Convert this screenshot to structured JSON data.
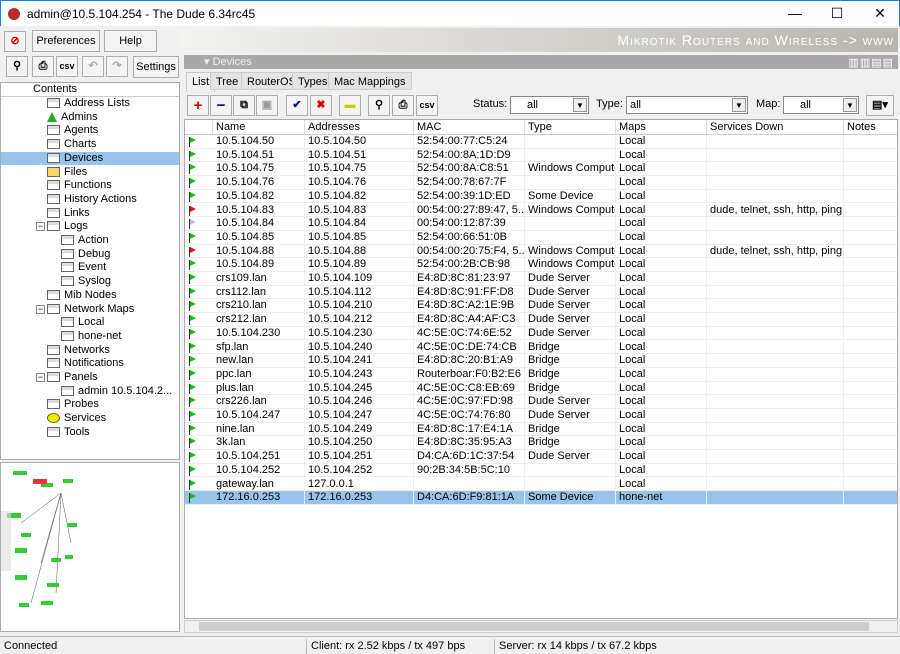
{
  "window": {
    "title": "admin@10.5.104.254 - The Dude 6.34rc45",
    "minimize": "—",
    "maximize": "☐",
    "close": "✕"
  },
  "menu": {
    "preferences": "Preferences",
    "help": "Help"
  },
  "banner": "Mikrotik Routers and Wireless -> www",
  "left_toolbar": {
    "csv": "csv",
    "settings": "Settings"
  },
  "tree": {
    "header": "Contents",
    "items": [
      {
        "label": "Address Lists",
        "level": 1,
        "icon": "table-icon"
      },
      {
        "label": "Admins",
        "level": 1,
        "icon": "admin-icon"
      },
      {
        "label": "Agents",
        "level": 1,
        "icon": "table-icon"
      },
      {
        "label": "Charts",
        "level": 1,
        "icon": "table-icon"
      },
      {
        "label": "Devices",
        "level": 1,
        "icon": "table-icon",
        "selected": true
      },
      {
        "label": "Files",
        "level": 1,
        "icon": "files-icon"
      },
      {
        "label": "Functions",
        "level": 1,
        "icon": "table-icon"
      },
      {
        "label": "History Actions",
        "level": 1,
        "icon": "table-icon"
      },
      {
        "label": "Links",
        "level": 1,
        "icon": "table-icon"
      },
      {
        "label": "Logs",
        "level": 1,
        "icon": "table-icon",
        "expanded": true
      },
      {
        "label": "Action",
        "level": 2,
        "icon": "log-icon"
      },
      {
        "label": "Debug",
        "level": 2,
        "icon": "log-icon"
      },
      {
        "label": "Event",
        "level": 2,
        "icon": "log-icon"
      },
      {
        "label": "Syslog",
        "level": 2,
        "icon": "log-icon"
      },
      {
        "label": "Mib Nodes",
        "level": 1,
        "icon": "table-icon"
      },
      {
        "label": "Network Maps",
        "level": 1,
        "icon": "table-icon",
        "expanded": true
      },
      {
        "label": "Local",
        "level": 2,
        "icon": "table-icon"
      },
      {
        "label": "hone-net",
        "level": 2,
        "icon": "table-icon"
      },
      {
        "label": "Networks",
        "level": 1,
        "icon": "table-icon"
      },
      {
        "label": "Notifications",
        "level": 1,
        "icon": "table-icon"
      },
      {
        "label": "Panels",
        "level": 1,
        "icon": "table-icon",
        "expanded": true
      },
      {
        "label": "admin 10.5.104.2...",
        "level": 2,
        "icon": "table-icon"
      },
      {
        "label": "Probes",
        "level": 1,
        "icon": "table-icon"
      },
      {
        "label": "Services",
        "level": 1,
        "icon": "services-icon"
      },
      {
        "label": "Tools",
        "level": 1,
        "icon": "table-icon"
      }
    ]
  },
  "devices": {
    "title": "Devices",
    "tabs": [
      "List",
      "Tree",
      "RouterOS",
      "Types",
      "Mac Mappings"
    ],
    "active_tab": "List",
    "toolbar": {
      "csv": "csv"
    },
    "filters": {
      "status_label": "Status:",
      "status_value": "all",
      "type_label": "Type:",
      "type_value": "all",
      "map_label": "Map:",
      "map_value": "all"
    },
    "columns": [
      "Name",
      "Addresses",
      "MAC",
      "Type",
      "Maps",
      "Services Down",
      "Notes"
    ],
    "status_colors": {
      "up": "#10c010",
      "down": "#e01010",
      "unknown": "#c0c0c0"
    },
    "rows": [
      {
        "status": "up",
        "name": "10.5.104.50",
        "addresses": "10.5.104.50",
        "mac": "52:54:00:77:C5:24",
        "type": "",
        "maps": "Local",
        "services_down": "",
        "notes": ""
      },
      {
        "status": "up",
        "name": "10.5.104.51",
        "addresses": "10.5.104.51",
        "mac": "52:54:00:8A:1D:D9",
        "type": "",
        "maps": "Local",
        "services_down": "",
        "notes": ""
      },
      {
        "status": "up",
        "name": "10.5.104.75",
        "addresses": "10.5.104.75",
        "mac": "52:54:00:8A:C8:51",
        "type": "Windows Computer",
        "maps": "Local",
        "services_down": "",
        "notes": ""
      },
      {
        "status": "up",
        "name": "10.5.104.76",
        "addresses": "10.5.104.76",
        "mac": "52:54:00:78:67:7F",
        "type": "",
        "maps": "Local",
        "services_down": "",
        "notes": ""
      },
      {
        "status": "up",
        "name": "10.5.104.82",
        "addresses": "10.5.104.82",
        "mac": "52:54:00:39:1D:ED",
        "type": "Some Device",
        "maps": "Local",
        "services_down": "",
        "notes": ""
      },
      {
        "status": "down",
        "name": "10.5.104.83",
        "addresses": "10.5.104.83",
        "mac": "00:54:00:27:89:47, 5...",
        "type": "Windows Computer",
        "maps": "Local",
        "services_down": "dude, telnet, ssh, http, ping,...",
        "notes": ""
      },
      {
        "status": "unknown",
        "name": "10.5.104.84",
        "addresses": "10.5.104.84",
        "mac": "00:54:00:12:87:39",
        "type": "",
        "maps": "Local",
        "services_down": "",
        "notes": ""
      },
      {
        "status": "up",
        "name": "10.5.104.85",
        "addresses": "10.5.104.85",
        "mac": "52:54:00:66:51:0B",
        "type": "",
        "maps": "Local",
        "services_down": "",
        "notes": ""
      },
      {
        "status": "down",
        "name": "10.5.104.88",
        "addresses": "10.5.104.88",
        "mac": "00:54:00:20:75:F4, 5...",
        "type": "Windows Computer",
        "maps": "Local",
        "services_down": "dude, telnet, ssh, http, ping,...",
        "notes": ""
      },
      {
        "status": "up",
        "name": "10.5.104.89",
        "addresses": "10.5.104.89",
        "mac": "52:54:00:2B:CB:98",
        "type": "Windows Computer",
        "maps": "Local",
        "services_down": "",
        "notes": ""
      },
      {
        "status": "up",
        "name": "crs109.lan",
        "addresses": "10.5.104.109",
        "mac": "E4:8D:8C:81:23:97",
        "type": "Dude Server",
        "maps": "Local",
        "services_down": "",
        "notes": ""
      },
      {
        "status": "up",
        "name": "crs112.lan",
        "addresses": "10.5.104.112",
        "mac": "E4:8D:8C:91:FF:D8",
        "type": "Dude Server",
        "maps": "Local",
        "services_down": "",
        "notes": ""
      },
      {
        "status": "up",
        "name": "crs210.lan",
        "addresses": "10.5.104.210",
        "mac": "E4:8D:8C:A2:1E:9B",
        "type": "Dude Server",
        "maps": "Local",
        "services_down": "",
        "notes": ""
      },
      {
        "status": "up",
        "name": "crs212.lan",
        "addresses": "10.5.104.212",
        "mac": "E4:8D:8C:A4:AF:C3",
        "type": "Dude Server",
        "maps": "Local",
        "services_down": "",
        "notes": ""
      },
      {
        "status": "up",
        "name": "10.5.104.230",
        "addresses": "10.5.104.230",
        "mac": "4C:5E:0C:74:6E:52",
        "type": "Dude Server",
        "maps": "Local",
        "services_down": "",
        "notes": ""
      },
      {
        "status": "up",
        "name": "sfp.lan",
        "addresses": "10.5.104.240",
        "mac": "4C:5E:0C:DE:74:CB",
        "type": "Bridge",
        "maps": "Local",
        "services_down": "",
        "notes": ""
      },
      {
        "status": "up",
        "name": "new.lan",
        "addresses": "10.5.104.241",
        "mac": "E4:8D:8C:20:B1:A9",
        "type": "Bridge",
        "maps": "Local",
        "services_down": "",
        "notes": ""
      },
      {
        "status": "up",
        "name": "ppc.lan",
        "addresses": "10.5.104.243",
        "mac": "Routerboar:F0:B2:E6",
        "type": "Bridge",
        "maps": "Local",
        "services_down": "",
        "notes": ""
      },
      {
        "status": "up",
        "name": "plus.lan",
        "addresses": "10.5.104.245",
        "mac": "4C:5E:0C:C8:EB:69",
        "type": "Bridge",
        "maps": "Local",
        "services_down": "",
        "notes": ""
      },
      {
        "status": "up",
        "name": "crs226.lan",
        "addresses": "10.5.104.246",
        "mac": "4C:5E:0C:97:FD:98",
        "type": "Dude Server",
        "maps": "Local",
        "services_down": "",
        "notes": ""
      },
      {
        "status": "up",
        "name": "10.5.104.247",
        "addresses": "10.5.104.247",
        "mac": "4C:5E:0C:74:76:80",
        "type": "Dude Server",
        "maps": "Local",
        "services_down": "",
        "notes": ""
      },
      {
        "status": "up",
        "name": "nine.lan",
        "addresses": "10.5.104.249",
        "mac": "E4:8D:8C:17:E4:1A",
        "type": "Bridge",
        "maps": "Local",
        "services_down": "",
        "notes": ""
      },
      {
        "status": "up",
        "name": "3k.lan",
        "addresses": "10.5.104.250",
        "mac": "E4:8D:8C:35:95:A3",
        "type": "Bridge",
        "maps": "Local",
        "services_down": "",
        "notes": ""
      },
      {
        "status": "up",
        "name": "10.5.104.251",
        "addresses": "10.5.104.251",
        "mac": "D4:CA:6D:1C:37:54",
        "type": "Dude Server",
        "maps": "Local",
        "services_down": "",
        "notes": ""
      },
      {
        "status": "up",
        "name": "10.5.104.252",
        "addresses": "10.5.104.252",
        "mac": "90:2B:34:5B:5C:10",
        "type": "",
        "maps": "Local",
        "services_down": "",
        "notes": ""
      },
      {
        "status": "up",
        "name": "gateway.lan",
        "addresses": "127.0.0.1",
        "mac": "",
        "type": "",
        "maps": "Local",
        "services_down": "",
        "notes": ""
      },
      {
        "status": "up",
        "name": "172.16.0.253",
        "addresses": "172.16.0.253",
        "mac": "D4:CA:6D:F9:81:1A",
        "type": "Some Device",
        "maps": "hone-net",
        "services_down": "",
        "notes": "",
        "selected": true
      }
    ]
  },
  "statusbar": {
    "connection": "Connected",
    "client": "Client: rx 2.52 kbps / tx 497 bps",
    "server": "Server: rx 14 kbps / tx 67.2 kbps"
  }
}
